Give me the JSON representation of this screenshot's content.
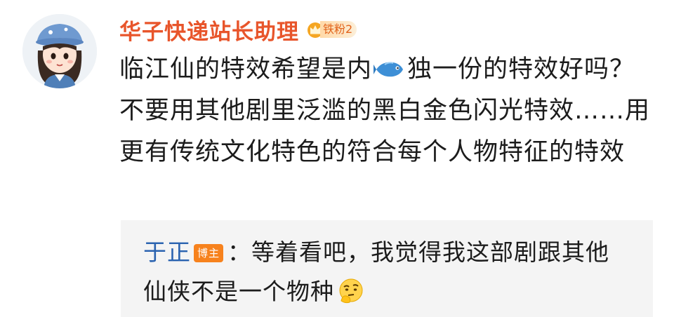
{
  "user": {
    "name": "华子快递站长助理",
    "fan_badge": "铁粉2",
    "icons": {
      "avatar": "cartoon-girl-avatar",
      "fan": "crown-icon"
    }
  },
  "comment": {
    "text_before_emoji": "临江仙的特效希望是内",
    "emoji": "fish-icon",
    "text_after_emoji": "独一份的特效好吗？不要用其他剧里泛滥的黑白金色闪光特效……用更有传统文化特色的符合每个人物特征的特效"
  },
  "reply": {
    "author": "于正",
    "author_badge": "博主",
    "separator": "：",
    "text": "等着看吧，我觉得我这部剧跟其他仙侠不是一个物种",
    "emoji": "thinking-icon"
  },
  "colors": {
    "username": "#e8552b",
    "reply_author": "#2a63b0",
    "blogger_badge": "#f7821d",
    "reply_bg": "#f4f4f4"
  }
}
